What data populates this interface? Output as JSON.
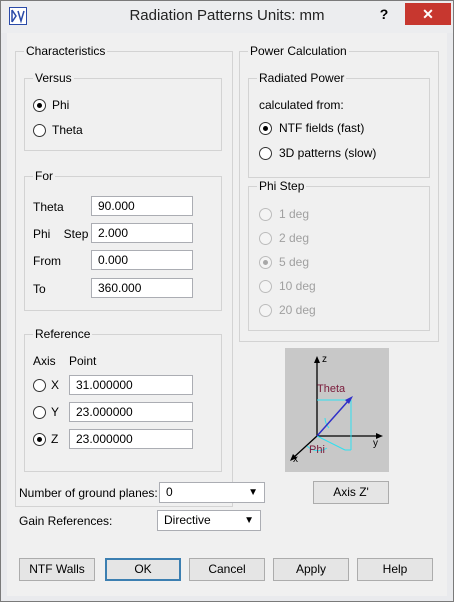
{
  "window": {
    "title": "Radiation Patterns   Units: mm",
    "help": "?",
    "close": "✕"
  },
  "characteristics": {
    "title": "Characteristics",
    "versus": {
      "title": "Versus",
      "options": [
        {
          "label": "Phi",
          "checked": true
        },
        {
          "label": "Theta",
          "checked": false
        }
      ]
    },
    "for": {
      "title": "For",
      "rows": [
        {
          "label": "Theta",
          "value": "90.000"
        },
        {
          "label": "Phi    Step",
          "value": "2.000"
        },
        {
          "label": "From",
          "value": "0.000"
        },
        {
          "label": "To",
          "value": "360.000"
        }
      ]
    },
    "reference": {
      "title": "Reference",
      "header_axis": "Axis",
      "header_point": "Point",
      "rows": [
        {
          "axis": "X",
          "value": "31.000000",
          "checked": false
        },
        {
          "axis": "Y",
          "value": "23.000000",
          "checked": false
        },
        {
          "axis": "Z",
          "value": "23.000000",
          "checked": true
        }
      ]
    }
  },
  "power": {
    "title": "Power Calculation",
    "radiated": {
      "title": "Radiated Power",
      "subtitle": "calculated from:",
      "options": [
        {
          "label": "NTF fields (fast)",
          "checked": true
        },
        {
          "label": "3D patterns (slow)",
          "checked": false
        }
      ]
    },
    "phi_step": {
      "title": "Phi Step",
      "options": [
        {
          "label": "1 deg",
          "checked": false
        },
        {
          "label": "2 deg",
          "checked": false
        },
        {
          "label": "5 deg",
          "checked": true
        },
        {
          "label": "10 deg",
          "checked": false
        },
        {
          "label": "20 deg",
          "checked": false
        }
      ]
    }
  },
  "diagram": {
    "z": "z",
    "theta": "Theta",
    "phi": "Phi",
    "x": "x",
    "y": "y",
    "colors": {
      "theta": "#7a1a3a",
      "phi": "#7a1a3a",
      "axis": "#000000",
      "accent_blue": "#3030c8",
      "accent_cyan": "#30e0f0"
    }
  },
  "ground": {
    "label": "Number of ground planes:",
    "value": "0"
  },
  "gain": {
    "label": "Gain References:",
    "value": "Directive"
  },
  "axis_z_button": "Axis Z'",
  "buttons": {
    "ntf_walls": "NTF Walls",
    "ok": "OK",
    "cancel": "Cancel",
    "apply": "Apply",
    "help": "Help"
  }
}
